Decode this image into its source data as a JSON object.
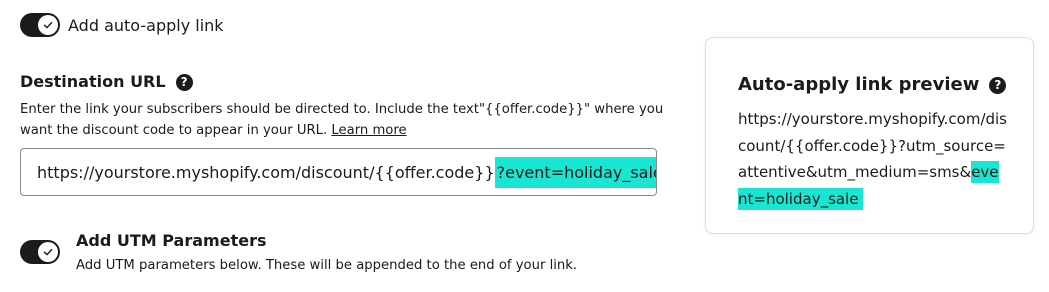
{
  "auto_apply": {
    "label": "Add auto-apply link",
    "enabled": true
  },
  "destination": {
    "title": "Destination URL",
    "description": "Enter the link your subscribers should be directed to. Include the text\"{{offer.code}}\" where you want the discount code to appear in your URL.",
    "learn_more": "Learn more",
    "url_base": "https://yourstore.myshopify.com/discount/{{offer.code}}",
    "url_highlight": "?event=holiday_sale"
  },
  "utm": {
    "title": "Add UTM Parameters",
    "description": "Add UTM parameters below. These will be appended to the end of your link.",
    "enabled": true
  },
  "preview": {
    "title": "Auto-apply link preview",
    "url_base": "https://yourstore.myshopify.com/discount/{{offer.code}}?utm_source=attentive&utm_medium=sms&",
    "url_highlight": "event=holiday_sale"
  },
  "colors": {
    "highlight": "#19e6d2",
    "toggle_on": "#1b1b1b"
  }
}
